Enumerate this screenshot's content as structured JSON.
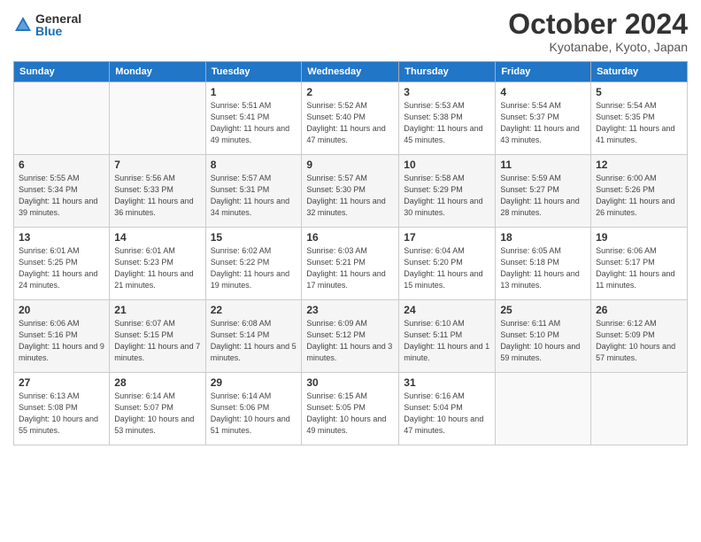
{
  "logo": {
    "general": "General",
    "blue": "Blue"
  },
  "title": "October 2024",
  "location": "Kyotanabe, Kyoto, Japan",
  "headers": [
    "Sunday",
    "Monday",
    "Tuesday",
    "Wednesday",
    "Thursday",
    "Friday",
    "Saturday"
  ],
  "weeks": [
    [
      {
        "day": "",
        "info": ""
      },
      {
        "day": "",
        "info": ""
      },
      {
        "day": "1",
        "info": "Sunrise: 5:51 AM\nSunset: 5:41 PM\nDaylight: 11 hours and 49 minutes."
      },
      {
        "day": "2",
        "info": "Sunrise: 5:52 AM\nSunset: 5:40 PM\nDaylight: 11 hours and 47 minutes."
      },
      {
        "day": "3",
        "info": "Sunrise: 5:53 AM\nSunset: 5:38 PM\nDaylight: 11 hours and 45 minutes."
      },
      {
        "day": "4",
        "info": "Sunrise: 5:54 AM\nSunset: 5:37 PM\nDaylight: 11 hours and 43 minutes."
      },
      {
        "day": "5",
        "info": "Sunrise: 5:54 AM\nSunset: 5:35 PM\nDaylight: 11 hours and 41 minutes."
      }
    ],
    [
      {
        "day": "6",
        "info": "Sunrise: 5:55 AM\nSunset: 5:34 PM\nDaylight: 11 hours and 39 minutes."
      },
      {
        "day": "7",
        "info": "Sunrise: 5:56 AM\nSunset: 5:33 PM\nDaylight: 11 hours and 36 minutes."
      },
      {
        "day": "8",
        "info": "Sunrise: 5:57 AM\nSunset: 5:31 PM\nDaylight: 11 hours and 34 minutes."
      },
      {
        "day": "9",
        "info": "Sunrise: 5:57 AM\nSunset: 5:30 PM\nDaylight: 11 hours and 32 minutes."
      },
      {
        "day": "10",
        "info": "Sunrise: 5:58 AM\nSunset: 5:29 PM\nDaylight: 11 hours and 30 minutes."
      },
      {
        "day": "11",
        "info": "Sunrise: 5:59 AM\nSunset: 5:27 PM\nDaylight: 11 hours and 28 minutes."
      },
      {
        "day": "12",
        "info": "Sunrise: 6:00 AM\nSunset: 5:26 PM\nDaylight: 11 hours and 26 minutes."
      }
    ],
    [
      {
        "day": "13",
        "info": "Sunrise: 6:01 AM\nSunset: 5:25 PM\nDaylight: 11 hours and 24 minutes."
      },
      {
        "day": "14",
        "info": "Sunrise: 6:01 AM\nSunset: 5:23 PM\nDaylight: 11 hours and 21 minutes."
      },
      {
        "day": "15",
        "info": "Sunrise: 6:02 AM\nSunset: 5:22 PM\nDaylight: 11 hours and 19 minutes."
      },
      {
        "day": "16",
        "info": "Sunrise: 6:03 AM\nSunset: 5:21 PM\nDaylight: 11 hours and 17 minutes."
      },
      {
        "day": "17",
        "info": "Sunrise: 6:04 AM\nSunset: 5:20 PM\nDaylight: 11 hours and 15 minutes."
      },
      {
        "day": "18",
        "info": "Sunrise: 6:05 AM\nSunset: 5:18 PM\nDaylight: 11 hours and 13 minutes."
      },
      {
        "day": "19",
        "info": "Sunrise: 6:06 AM\nSunset: 5:17 PM\nDaylight: 11 hours and 11 minutes."
      }
    ],
    [
      {
        "day": "20",
        "info": "Sunrise: 6:06 AM\nSunset: 5:16 PM\nDaylight: 11 hours and 9 minutes."
      },
      {
        "day": "21",
        "info": "Sunrise: 6:07 AM\nSunset: 5:15 PM\nDaylight: 11 hours and 7 minutes."
      },
      {
        "day": "22",
        "info": "Sunrise: 6:08 AM\nSunset: 5:14 PM\nDaylight: 11 hours and 5 minutes."
      },
      {
        "day": "23",
        "info": "Sunrise: 6:09 AM\nSunset: 5:12 PM\nDaylight: 11 hours and 3 minutes."
      },
      {
        "day": "24",
        "info": "Sunrise: 6:10 AM\nSunset: 5:11 PM\nDaylight: 11 hours and 1 minute."
      },
      {
        "day": "25",
        "info": "Sunrise: 6:11 AM\nSunset: 5:10 PM\nDaylight: 10 hours and 59 minutes."
      },
      {
        "day": "26",
        "info": "Sunrise: 6:12 AM\nSunset: 5:09 PM\nDaylight: 10 hours and 57 minutes."
      }
    ],
    [
      {
        "day": "27",
        "info": "Sunrise: 6:13 AM\nSunset: 5:08 PM\nDaylight: 10 hours and 55 minutes."
      },
      {
        "day": "28",
        "info": "Sunrise: 6:14 AM\nSunset: 5:07 PM\nDaylight: 10 hours and 53 minutes."
      },
      {
        "day": "29",
        "info": "Sunrise: 6:14 AM\nSunset: 5:06 PM\nDaylight: 10 hours and 51 minutes."
      },
      {
        "day": "30",
        "info": "Sunrise: 6:15 AM\nSunset: 5:05 PM\nDaylight: 10 hours and 49 minutes."
      },
      {
        "day": "31",
        "info": "Sunrise: 6:16 AM\nSunset: 5:04 PM\nDaylight: 10 hours and 47 minutes."
      },
      {
        "day": "",
        "info": ""
      },
      {
        "day": "",
        "info": ""
      }
    ]
  ]
}
